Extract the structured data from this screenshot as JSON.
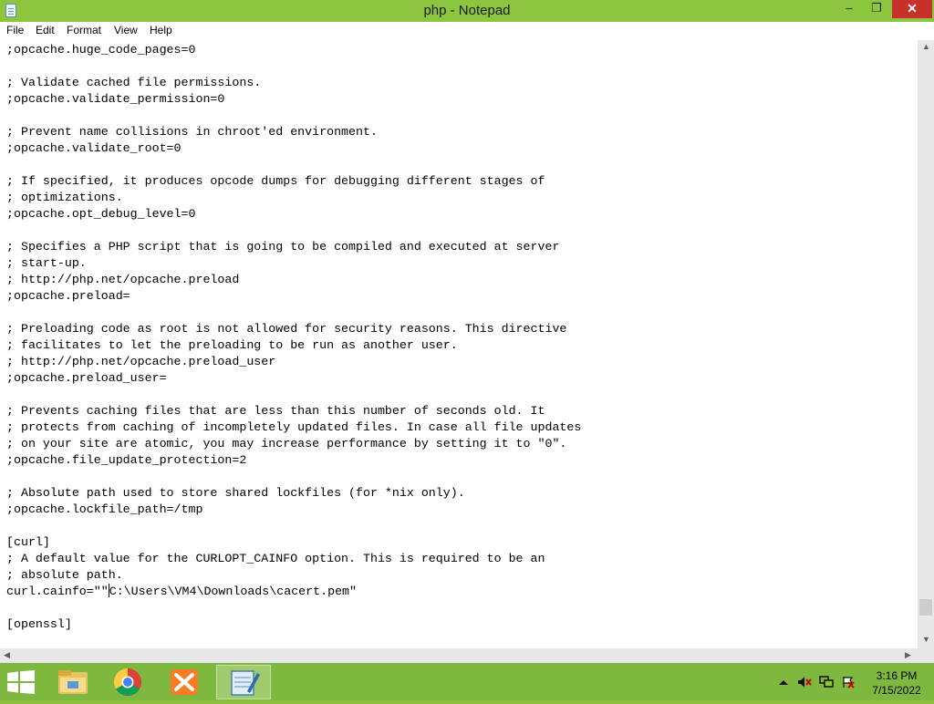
{
  "window": {
    "title": "php - Notepad",
    "minimize_glyph": "–",
    "maximize_glyph": "❐",
    "close_glyph": "✕"
  },
  "menu": {
    "file": "File",
    "edit": "Edit",
    "format": "Format",
    "view": "View",
    "help": "Help"
  },
  "editor": {
    "lines_before_caret": ";opcache.huge_code_pages=0\n\n; Validate cached file permissions.\n;opcache.validate_permission=0\n\n; Prevent name collisions in chroot'ed environment.\n;opcache.validate_root=0\n\n; If specified, it produces opcode dumps for debugging different stages of\n; optimizations.\n;opcache.opt_debug_level=0\n\n; Specifies a PHP script that is going to be compiled and executed at server\n; start-up.\n; http://php.net/opcache.preload\n;opcache.preload=\n\n; Preloading code as root is not allowed for security reasons. This directive\n; facilitates to let the preloading to be run as another user.\n; http://php.net/opcache.preload_user\n;opcache.preload_user=\n\n; Prevents caching files that are less than this number of seconds old. It\n; protects from caching of incompletely updated files. In case all file updates\n; on your site are atomic, you may increase performance by setting it to \"0\".\n;opcache.file_update_protection=2\n\n; Absolute path used to store shared lockfiles (for *nix only).\n;opcache.lockfile_path=/tmp\n\n[curl]\n; A default value for the CURLOPT_CAINFO option. This is required to be an\n; absolute path.\ncurl.cainfo=\"\"",
    "text_after_caret": "C:\\Users\\VM4\\Downloads\\cacert.pem\"\n\n[openssl]"
  },
  "taskbar": {
    "items": [
      "start-button",
      "file-explorer",
      "chrome",
      "xampp",
      "notepad"
    ],
    "active": "notepad"
  },
  "clock": {
    "time": "3:16 PM",
    "date": "7/15/2022"
  },
  "colors": {
    "accent": "#8cc63f",
    "taskbar": "#7fb83e",
    "close": "#c7312b"
  }
}
